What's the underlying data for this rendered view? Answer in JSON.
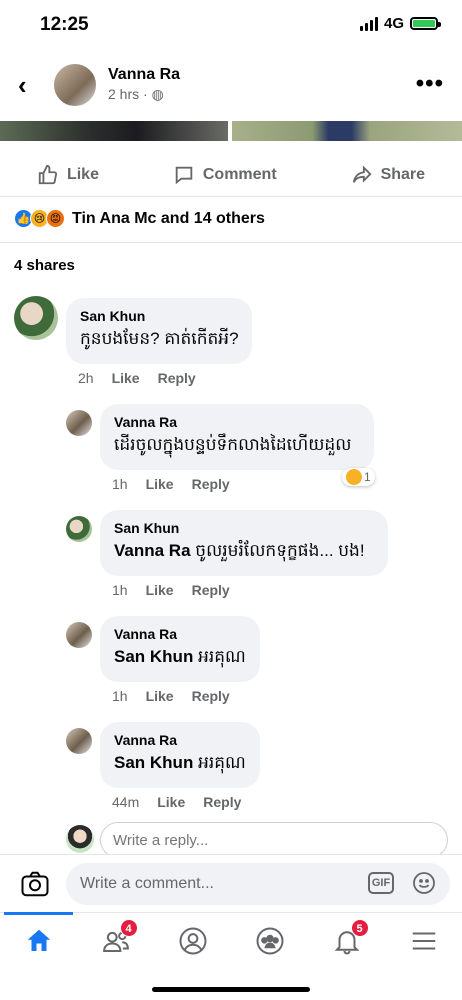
{
  "status": {
    "time": "12:25",
    "network": "4G"
  },
  "post": {
    "author": "Vanna Ra",
    "time": "2 hrs",
    "privacy_icon": "globe-icon"
  },
  "actions": {
    "like": "Like",
    "comment": "Comment",
    "share": "Share"
  },
  "reactions": {
    "text": "Tin Ana Mc and 14 others",
    "icons": [
      "like",
      "sad",
      "angry"
    ]
  },
  "shares": "4 shares",
  "comments": [
    {
      "name": "San Khun",
      "mention": "",
      "text": "កូនបងមែន? គាត់កើតអី?",
      "time": "2h",
      "like": "Like",
      "reply": "Reply"
    },
    {
      "name": "Vanna Ra",
      "mention": "",
      "text": "ដើរចូលក្នុងបន្ទប់ទឹកលាងដៃហើយដួល",
      "time": "1h",
      "like": "Like",
      "reply": "Reply",
      "reaction_count": "1"
    },
    {
      "name": "San Khun",
      "mention": "Vanna Ra",
      "text": "ចូលរួមរំលែកទុក្ខផង... បង!",
      "time": "1h",
      "like": "Like",
      "reply": "Reply"
    },
    {
      "name": "Vanna Ra",
      "mention": "San Khun",
      "text": "អរគុណ",
      "time": "1h",
      "like": "Like",
      "reply": "Reply"
    },
    {
      "name": "Vanna Ra",
      "mention": "San Khun",
      "text": "អរគុណ",
      "time": "44m",
      "like": "Like",
      "reply": "Reply"
    }
  ],
  "reply_placeholder": "Write a reply...",
  "comment_placeholder": "Write a comment...",
  "gif_label": "GIF",
  "tabs": [
    {
      "name": "home",
      "badge": ""
    },
    {
      "name": "friends",
      "badge": "4"
    },
    {
      "name": "profile",
      "badge": ""
    },
    {
      "name": "groups",
      "badge": ""
    },
    {
      "name": "notifications",
      "badge": "5"
    },
    {
      "name": "menu",
      "badge": ""
    }
  ],
  "colors": {
    "accent": "#1877f2",
    "badge": "#e41e3f",
    "meta": "#65676b",
    "bubble": "#f0f2f5"
  }
}
